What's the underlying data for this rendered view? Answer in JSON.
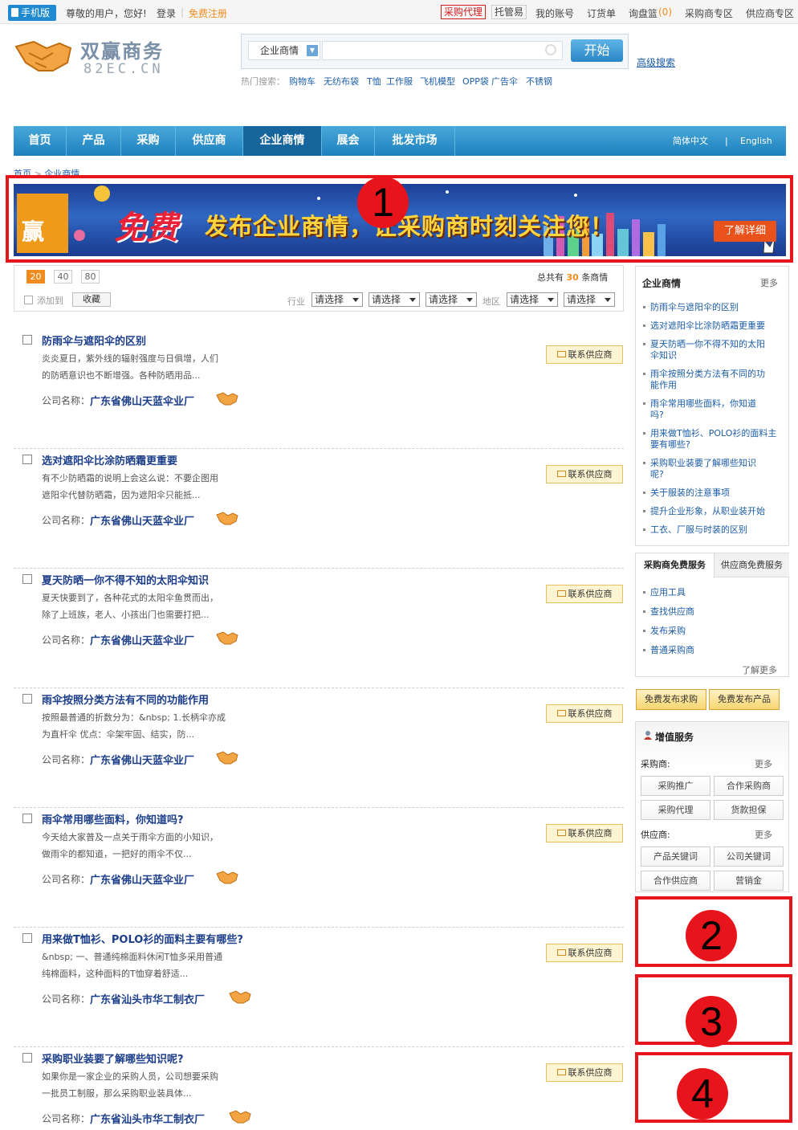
{
  "topbar": {
    "mobile": "手机版",
    "greeting": "尊敬的用户，您好!",
    "login": "登录",
    "register": "免费注册",
    "links": [
      "采购代理",
      "托管易",
      "我的账号",
      "订货单",
      "询盘篮",
      "(0)",
      "采购商专区",
      "供应商专区"
    ]
  },
  "header": {
    "logo_cn": "双赢商务",
    "logo_en": "82EC.CN",
    "search_category": "企业商情",
    "search_button": "开始",
    "advanced": "高级搜索",
    "hot_label": "热门搜索：",
    "hot_terms": [
      "购物车",
      "无纺布袋",
      "T恤",
      "工作服",
      "飞机模型",
      "OPP袋",
      "广告伞",
      "不锈钢"
    ]
  },
  "nav": {
    "items": [
      "首页",
      "产品",
      "采购",
      "供应商",
      "企业商情",
      "展会",
      "批发市场"
    ],
    "active": "企业商情",
    "lang_cn": "简体中文",
    "lang_sep": "|",
    "lang_en": "English"
  },
  "breadcrumb": {
    "home": "首页",
    "sep": ">",
    "current": "企业商情"
  },
  "banner": {
    "left_char": "赢",
    "free": "免费",
    "slogan": "发布企业商情，让采购商时刻关注您！",
    "button": "了解详细"
  },
  "markers": [
    "1",
    "2",
    "3",
    "4"
  ],
  "controls": {
    "page_sizes": [
      "20",
      "40",
      "80"
    ],
    "active_size": "20",
    "total_prefix": "总共有",
    "total_count": "30",
    "total_suffix": "条商情",
    "add_to": "添加到",
    "collect": "收藏",
    "industry": "行业",
    "region": "地区",
    "select_placeholder": "请选择"
  },
  "list": {
    "company_label": "公司名称：",
    "contact": "联系供应商",
    "items": [
      {
        "title": "防雨伞与遮阳伞的区别",
        "desc1": "炎炎夏日，紫外线的辐射强度与日俱增，人们",
        "desc2": "的防晒意识也不断增强。各种防晒用品...",
        "company": "广东省佛山天蓝伞业厂"
      },
      {
        "title": "选对遮阳伞比涂防晒霜更重要",
        "desc1": "有不少防晒霜的说明上会这么说：不要企图用",
        "desc2": "遮阳伞代替防晒霜，因为遮阳伞只能抵...",
        "company": "广东省佛山天蓝伞业厂"
      },
      {
        "title": "夏天防晒一你不得不知的太阳伞知识",
        "desc1": "夏天快要到了，各种花式的太阳伞鱼贯而出，",
        "desc2": "除了上班族，老人、小孩出门也需要打把...",
        "company": "广东省佛山天蓝伞业厂"
      },
      {
        "title": "雨伞按照分类方法有不同的功能作用",
        "desc1": "按照最普通的折数分为：&nbsp; 1.长柄伞亦成",
        "desc2": "为直杆伞 优点：伞架牢固、结实，防...",
        "company": "广东省佛山天蓝伞业厂"
      },
      {
        "title": "雨伞常用哪些面料，你知道吗?",
        "desc1": "今天给大家普及一点关于雨伞方面的小知识，",
        "desc2": "做雨伞的都知道，一把好的雨伞不仅...",
        "company": "广东省佛山天蓝伞业厂"
      },
      {
        "title": "用来做T恤衫、POLO衫的面料主要有哪些?",
        "desc1": "&nbsp; 一、普通纯棉面料休闲T恤多采用普通",
        "desc2": "纯棉面料，这种面料的T恤穿着舒适...",
        "company": "广东省汕头市华工制衣厂"
      },
      {
        "title": "采购职业装要了解哪些知识呢?",
        "desc1": "如果你是一家企业的采购人员，公司想要采购",
        "desc2": "一批员工制服，那么采购职业装具体...",
        "company": "广东省汕头市华工制衣厂"
      }
    ]
  },
  "sidebar": {
    "news": {
      "title": "企业商情",
      "more": "更多",
      "links": [
        [
          "防雨伞与遮阳伞的区别"
        ],
        [
          "选对遮阳伞比涂防晒霜更重要"
        ],
        [
          "夏天防晒一你不得不知的太阳",
          "伞知识"
        ],
        [
          "雨伞按照分类方法有不同的功",
          "能作用"
        ],
        [
          "雨伞常用哪些面料，你知道",
          "吗?"
        ],
        [
          "用来做T恤衫、POLO衫的面料主",
          "要有哪些?"
        ],
        [
          "采购职业装要了解哪些知识",
          "呢?"
        ],
        [
          "关于服装的注意事项"
        ],
        [
          "提升企业形象，从职业装开始"
        ],
        [
          "工衣、厂服与时装的区别"
        ]
      ]
    },
    "services": {
      "tab_buyer": "采购商免费服务",
      "tab_supplier": "供应商免费服务",
      "links": [
        "应用工具",
        "查找供应商",
        "发布采购",
        "普通采购商"
      ],
      "more": "了解更多"
    },
    "free_buttons": [
      "免费发布求购",
      "免费发布产品"
    ],
    "value_added": {
      "title": "增值服务",
      "buyer_label": "采购商:",
      "supplier_label": "供应商:",
      "more": "更多",
      "buyer_buttons": [
        "采购推广",
        "合作采购商",
        "采购代理",
        "货款担保"
      ],
      "supplier_buttons": [
        "产品关键词",
        "公司关键词",
        "合作供应商",
        "营销金"
      ]
    }
  }
}
